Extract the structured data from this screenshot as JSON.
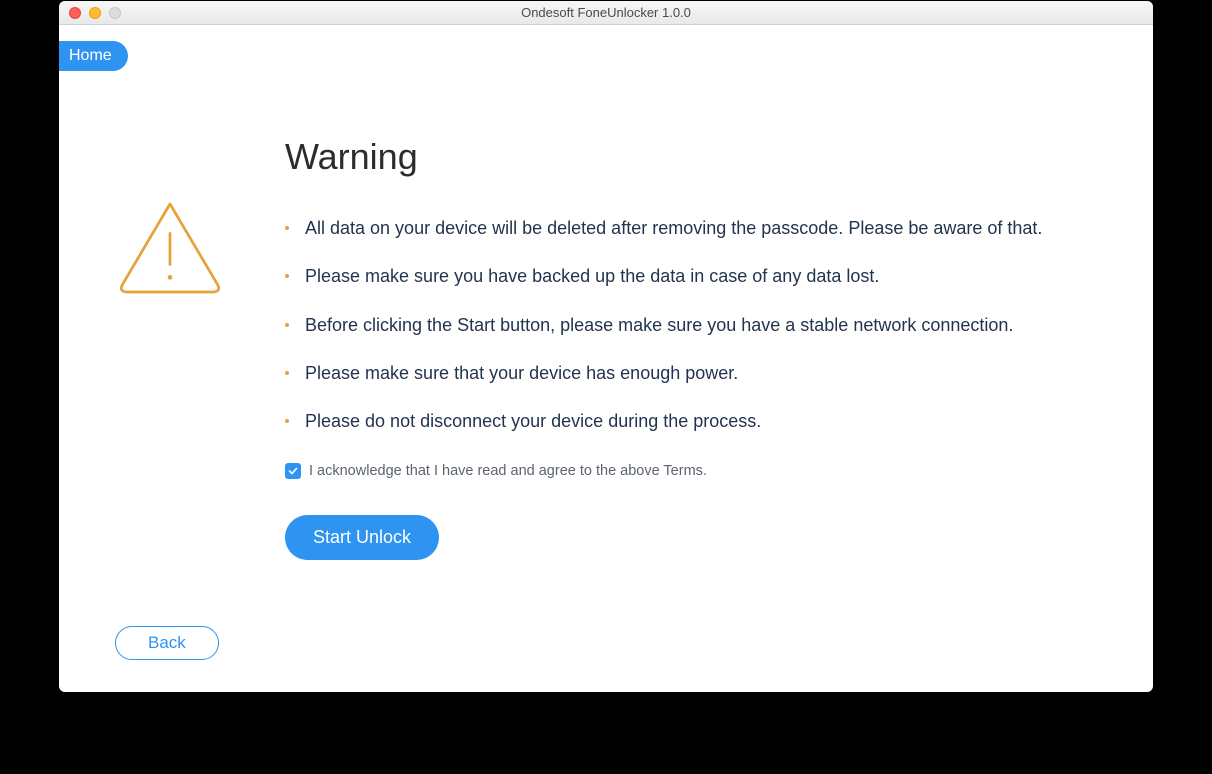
{
  "titlebar": {
    "title": "Ondesoft FoneUnlocker 1.0.0"
  },
  "nav": {
    "home_label": "Home"
  },
  "warning": {
    "heading": "Warning",
    "items": [
      "All data on your device will be deleted after removing the passcode. Please be aware of that.",
      "Please make sure you have backed up the data in case of any data lost.",
      "Before clicking the Start button, please make sure you have a stable network connection.",
      "Please make sure that your device has enough power.",
      "Please do not disconnect your device during the process."
    ],
    "ack_label": "I acknowledge that I have read and agree to the above Terms.",
    "ack_checked": true
  },
  "buttons": {
    "start_label": "Start Unlock",
    "back_label": "Back"
  },
  "colors": {
    "accent": "#2f94f1",
    "bullet": "#e6a33a",
    "body_text": "#22344f"
  }
}
